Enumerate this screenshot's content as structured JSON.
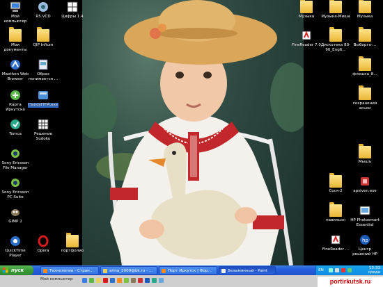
{
  "colors": {
    "taskbar": "#245edb",
    "start": "#3a9a37",
    "tray": "#0f8ce0",
    "selection": "#316ac5",
    "watermark_text": "#cc0000"
  },
  "desktop": {
    "left_icons": [
      {
        "label": "Мой компьютер",
        "icon": "my-computer-icon"
      },
      {
        "label": "R5.VCD",
        "icon": "app-icon"
      },
      {
        "label": "Цифры 1.4",
        "icon": "numbers-icon"
      },
      {
        "label": "Мои документы",
        "icon": "folder-icon"
      },
      {
        "label": "QIP Infium",
        "icon": "folder-icon"
      },
      {
        "label": "Maxthon Web Browser",
        "icon": "maxthon-icon"
      },
      {
        "label": "Образ понимается ...",
        "icon": "document-icon"
      },
      {
        "label": "Карта Иркутска",
        "icon": "map-icon"
      },
      {
        "label": "HandyHTM.exe",
        "icon": "app-icon"
      },
      {
        "label": "Tomca",
        "icon": "app-icon"
      },
      {
        "label": "Решение Sudoku",
        "icon": "sudoku-icon"
      },
      {
        "label": "Sony Ericsson File Manager",
        "icon": "sony-icon"
      },
      {
        "label": "Sony Ericsson PC Suite",
        "icon": "sony-icon"
      },
      {
        "label": "GIMP 2",
        "icon": "gimp-icon"
      },
      {
        "label": "QuickTime Player",
        "icon": "quicktime-icon"
      },
      {
        "label": "Opera",
        "icon": "opera-icon"
      },
      {
        "label": "портфолио",
        "icon": "folder-icon"
      }
    ],
    "right_icons": [
      {
        "label": "Музыка",
        "icon": "folder-icon"
      },
      {
        "label": "Музыка-Миша",
        "icon": "folder-icon"
      },
      {
        "label": "Музыка",
        "icon": "folder-icon"
      },
      {
        "label": "FineReader 7.0",
        "icon": "finereader-icon"
      },
      {
        "label": "Дискотека 80-90_Eng6...",
        "icon": "folder-icon"
      },
      {
        "label": "Выборга-...",
        "icon": "folder-icon"
      },
      {
        "label": "флешка_8...",
        "icon": "folder-icon"
      },
      {
        "label": "сохранения аськи",
        "icon": "folder-icon"
      },
      {
        "label": "Мышъ",
        "icon": "folder-icon"
      },
      {
        "label": "Сося-2",
        "icon": "folder-icon"
      },
      {
        "label": "apsiven.exe",
        "icon": "app-icon"
      },
      {
        "label": "павильон",
        "icon": "folder-icon"
      },
      {
        "label": "HP Photosmart Essential",
        "icon": "hp-icon"
      },
      {
        "label": "FineReader ...",
        "icon": "finereader-icon"
      },
      {
        "label": "Центр решений HP",
        "icon": "hp-icon"
      }
    ]
  },
  "taskbar": {
    "start_label": "пуск",
    "tasks": [
      {
        "label": "Технологии - Стран..."
      },
      {
        "label": "arina_2009@bk.ru - ..."
      },
      {
        "label": "Порт Иркутск | Фор..."
      },
      {
        "label": "Безымянный - Paint"
      }
    ],
    "lang": "EN",
    "clock": "13:33",
    "clock_day": "среда"
  },
  "quickbar": {
    "label": "Мой компьютер"
  },
  "watermark": "portirkutsk.ru"
}
